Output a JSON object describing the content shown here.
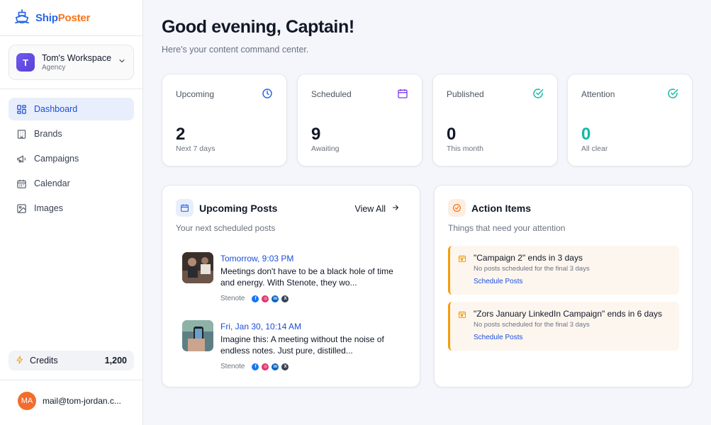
{
  "brand": {
    "name_part1": "Ship",
    "name_part2": "Poster",
    "primary": "#2563eb",
    "accent": "#f97316"
  },
  "workspace": {
    "initial": "T",
    "name": "Tom's Workspace",
    "type": "Agency"
  },
  "nav": [
    {
      "label": "Dashboard",
      "icon": "dashboard-icon",
      "active": true
    },
    {
      "label": "Brands",
      "icon": "building-icon"
    },
    {
      "label": "Campaigns",
      "icon": "megaphone-icon"
    },
    {
      "label": "Calendar",
      "icon": "calendar-icon"
    },
    {
      "label": "Images",
      "icon": "image-icon"
    }
  ],
  "credits": {
    "label": "Credits",
    "value": "1,200"
  },
  "user": {
    "initials": "MA",
    "email": "mail@tom-jordan.c..."
  },
  "header": {
    "title": "Good evening, Captain!",
    "subtitle": "Here's your content command center."
  },
  "stats": [
    {
      "label": "Upcoming",
      "value": "2",
      "sub": "Next 7 days",
      "icon": "clock-icon",
      "color": "#2563eb"
    },
    {
      "label": "Scheduled",
      "value": "9",
      "sub": "Awaiting",
      "icon": "calendar-icon",
      "color": "#7c3aed"
    },
    {
      "label": "Published",
      "value": "0",
      "sub": "This month",
      "icon": "check-circle-icon",
      "color": "#14b8a6"
    },
    {
      "label": "Attention",
      "value": "0",
      "sub": "All clear",
      "icon": "check-circle-icon",
      "color": "#14b8a6"
    }
  ],
  "upcoming": {
    "title": "Upcoming Posts",
    "subtitle": "Your next scheduled posts",
    "view_all": "View All",
    "posts": [
      {
        "when": "Tomorrow, 9:03 PM",
        "text": "Meetings don't have to be a black hole of time and energy. With Stenote, they wo...",
        "brand": "Stenote"
      },
      {
        "when": "Fri, Jan 30, 10:14 AM",
        "text": "Imagine this: A meeting without the noise of endless notes. Just pure, distilled...",
        "brand": "Stenote"
      }
    ]
  },
  "actions": {
    "title": "Action Items",
    "subtitle": "Things that need your attention",
    "items": [
      {
        "title": "\"Campaign 2\" ends in 3 days",
        "sub": "No posts scheduled for the final 3 days",
        "link": "Schedule Posts"
      },
      {
        "title": "\"Zors January LinkedIn Campaign\" ends in 6 days",
        "sub": "No posts scheduled for the final 3 days",
        "link": "Schedule Posts"
      }
    ]
  }
}
